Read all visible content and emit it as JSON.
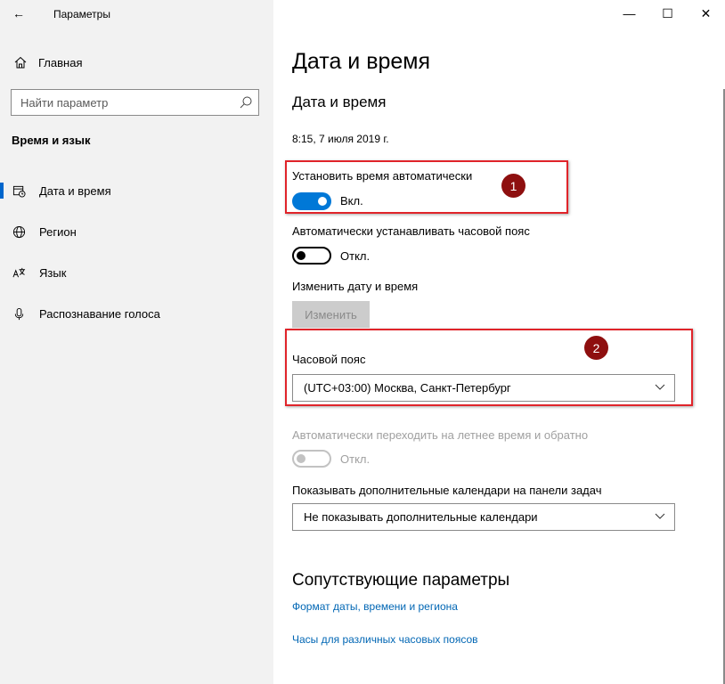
{
  "window": {
    "app_title": "Параметры",
    "back_icon": "←",
    "minimize_icon": "—",
    "maximize_icon": "☐",
    "close_icon": "✕"
  },
  "sidebar": {
    "home_label": "Главная",
    "search_placeholder": "Найти параметр",
    "section_label": "Время и язык",
    "items": [
      {
        "label": "Дата и время",
        "icon": "calendar-clock-icon",
        "active": true
      },
      {
        "label": "Регион",
        "icon": "globe-icon",
        "active": false
      },
      {
        "label": "Язык",
        "icon": "language-icon",
        "active": false
      },
      {
        "label": "Распознавание голоса",
        "icon": "microphone-icon",
        "active": false
      }
    ]
  },
  "main": {
    "page_title": "Дата и время",
    "sub_title": "Дата и время",
    "current_time": "8:15, 7 июля 2019 г.",
    "auto_time": {
      "label": "Установить время автоматически",
      "state": "Вкл.",
      "on": true
    },
    "auto_tz": {
      "label": "Автоматически устанавливать часовой пояс",
      "state": "Откл.",
      "on": false
    },
    "change_dt": {
      "label": "Изменить дату и время",
      "button": "Изменить"
    },
    "timezone": {
      "label": "Часовой пояс",
      "value": "(UTC+03:00) Москва, Санкт-Петербург"
    },
    "dst": {
      "label": "Автоматически переходить на летнее время и обратно",
      "state": "Откл."
    },
    "calendars": {
      "label": "Показывать дополнительные календари на панели задач",
      "value": "Не показывать дополнительные календари"
    },
    "related": {
      "title": "Сопутствующие параметры",
      "links": [
        "Формат даты, времени и региона",
        "Часы для различных часовых поясов"
      ]
    }
  },
  "annotations": {
    "badge1": "1",
    "badge2": "2",
    "color": "#e0242a",
    "badge_color": "#8e0f0f"
  },
  "colors": {
    "accent": "#0078d7",
    "link": "#0066b4",
    "sidebar_bg": "#f2f2f2"
  }
}
